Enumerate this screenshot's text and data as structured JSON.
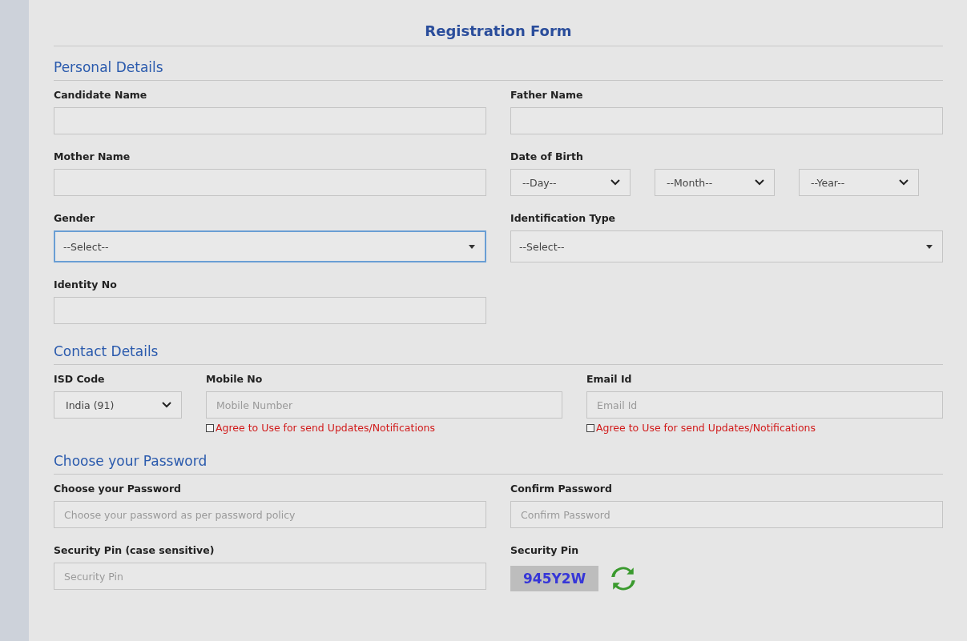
{
  "title": "Registration Form",
  "sections": [
    {
      "title": "Personal Details",
      "rows": [
        {
          "fields": [
            {
              "kind": "text",
              "label": "Candidate Name"
            },
            {
              "kind": "text",
              "label": "Father Name"
            }
          ]
        },
        {
          "fields": [
            {
              "kind": "text",
              "label": "Mother Name"
            },
            {
              "kind": "date",
              "label": "Date of Birth",
              "selects": [
                "--Day--",
                "--Month--",
                "--Year--"
              ]
            }
          ]
        },
        {
          "fields": [
            {
              "kind": "dropdown",
              "label": "Gender",
              "value": "--Select--",
              "focused": true
            },
            {
              "kind": "dropdown",
              "label": "Identification Type",
              "value": "--Select--",
              "focused": false
            }
          ]
        },
        {
          "fields": [
            {
              "kind": "text",
              "label": "Identity No"
            }
          ]
        }
      ]
    },
    {
      "title": "Contact Details",
      "rows": [
        {
          "fields": [
            {
              "kind": "select",
              "label": "ISD Code",
              "value": "India (91)"
            },
            {
              "kind": "text",
              "label": "Mobile No",
              "placeholder": "Mobile Number",
              "agree": {
                "label": "Agree to Use for send Updates/Notifications",
                "checked": false
              }
            },
            {
              "kind": "text",
              "label": "Email Id",
              "placeholder": "Email Id",
              "agree": {
                "label": "Agree to Use for send Updates/Notifications",
                "checked": false
              }
            }
          ]
        }
      ]
    },
    {
      "title": "Choose your Password",
      "rows": [
        {
          "fields": [
            {
              "kind": "text",
              "label": "Choose your Password",
              "placeholder": "Choose your password as per password policy"
            },
            {
              "kind": "text",
              "label": "Confirm Password",
              "placeholder": "Confirm Password"
            }
          ]
        },
        {
          "fields": [
            {
              "kind": "text",
              "label": "Security Pin (case sensitive)",
              "placeholder": "Security Pin"
            },
            {
              "kind": "captcha",
              "label": "Security Pin",
              "code": "945Y2W"
            }
          ]
        }
      ]
    }
  ]
}
